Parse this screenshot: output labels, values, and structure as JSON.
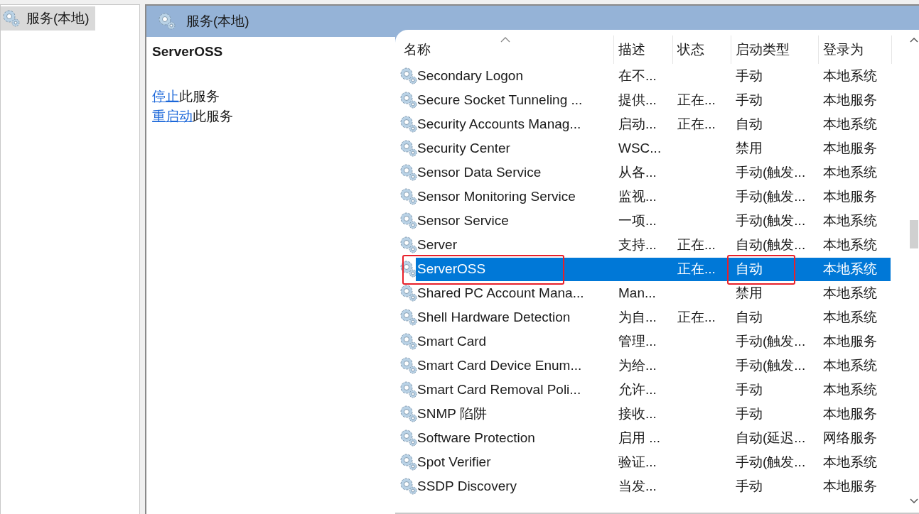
{
  "tree": {
    "items": [
      {
        "label": "服务(本地)",
        "selected": true
      }
    ]
  },
  "panel": {
    "title": "服务(本地)"
  },
  "details": {
    "service_name": "ServerOSS",
    "actions": [
      {
        "link": "停止",
        "rest": "此服务"
      },
      {
        "link": "重启动",
        "rest": "此服务"
      }
    ]
  },
  "table": {
    "columns": [
      {
        "label": "名称",
        "sorted": true
      },
      {
        "label": "描述",
        "sorted": false
      },
      {
        "label": "状态",
        "sorted": false
      },
      {
        "label": "启动类型",
        "sorted": false
      },
      {
        "label": "登录为",
        "sorted": false
      }
    ],
    "rows": [
      {
        "name": "Secondary Logon",
        "description": "在不...",
        "status": "",
        "startup": "手动",
        "logon": "本地系统",
        "selected": false,
        "name_boxed": false,
        "startup_boxed": false
      },
      {
        "name": "Secure Socket Tunneling ...",
        "description": "提供...",
        "status": "正在...",
        "startup": "手动",
        "logon": "本地服务",
        "selected": false,
        "name_boxed": false,
        "startup_boxed": false
      },
      {
        "name": "Security Accounts Manag...",
        "description": "启动...",
        "status": "正在...",
        "startup": "自动",
        "logon": "本地系统",
        "selected": false,
        "name_boxed": false,
        "startup_boxed": false
      },
      {
        "name": "Security Center",
        "description": "WSC...",
        "status": "",
        "startup": "禁用",
        "logon": "本地服务",
        "selected": false,
        "name_boxed": false,
        "startup_boxed": false
      },
      {
        "name": "Sensor Data Service",
        "description": "从各...",
        "status": "",
        "startup": "手动(触发...",
        "logon": "本地系统",
        "selected": false,
        "name_boxed": false,
        "startup_boxed": false
      },
      {
        "name": "Sensor Monitoring Service",
        "description": "监视...",
        "status": "",
        "startup": "手动(触发...",
        "logon": "本地服务",
        "selected": false,
        "name_boxed": false,
        "startup_boxed": false
      },
      {
        "name": "Sensor Service",
        "description": "一项...",
        "status": "",
        "startup": "手动(触发...",
        "logon": "本地系统",
        "selected": false,
        "name_boxed": false,
        "startup_boxed": false
      },
      {
        "name": "Server",
        "description": "支持...",
        "status": "正在...",
        "startup": "自动(触发...",
        "logon": "本地系统",
        "selected": false,
        "name_boxed": false,
        "startup_boxed": false
      },
      {
        "name": "ServerOSS",
        "description": "",
        "status": "正在...",
        "startup": "自动",
        "logon": "本地系统",
        "selected": true,
        "name_boxed": true,
        "startup_boxed": true
      },
      {
        "name": "Shared PC Account Mana...",
        "description": "Man...",
        "status": "",
        "startup": "禁用",
        "logon": "本地系统",
        "selected": false,
        "name_boxed": false,
        "startup_boxed": false
      },
      {
        "name": "Shell Hardware Detection",
        "description": "为自...",
        "status": "正在...",
        "startup": "自动",
        "logon": "本地系统",
        "selected": false,
        "name_boxed": false,
        "startup_boxed": false
      },
      {
        "name": "Smart Card",
        "description": "管理...",
        "status": "",
        "startup": "手动(触发...",
        "logon": "本地服务",
        "selected": false,
        "name_boxed": false,
        "startup_boxed": false
      },
      {
        "name": "Smart Card Device Enum...",
        "description": "为给...",
        "status": "",
        "startup": "手动(触发...",
        "logon": "本地系统",
        "selected": false,
        "name_boxed": false,
        "startup_boxed": false
      },
      {
        "name": "Smart Card Removal Poli...",
        "description": "允许...",
        "status": "",
        "startup": "手动",
        "logon": "本地系统",
        "selected": false,
        "name_boxed": false,
        "startup_boxed": false
      },
      {
        "name": "SNMP 陷阱",
        "description": "接收...",
        "status": "",
        "startup": "手动",
        "logon": "本地服务",
        "selected": false,
        "name_boxed": false,
        "startup_boxed": false
      },
      {
        "name": "Software Protection",
        "description": "启用 ...",
        "status": "",
        "startup": "自动(延迟...",
        "logon": "网络服务",
        "selected": false,
        "name_boxed": false,
        "startup_boxed": false
      },
      {
        "name": "Spot Verifier",
        "description": "验证...",
        "status": "",
        "startup": "手动(触发...",
        "logon": "本地系统",
        "selected": false,
        "name_boxed": false,
        "startup_boxed": false
      },
      {
        "name": "SSDP Discovery",
        "description": "当发...",
        "status": "",
        "startup": "手动",
        "logon": "本地服务",
        "selected": false,
        "name_boxed": false,
        "startup_boxed": false
      }
    ]
  }
}
